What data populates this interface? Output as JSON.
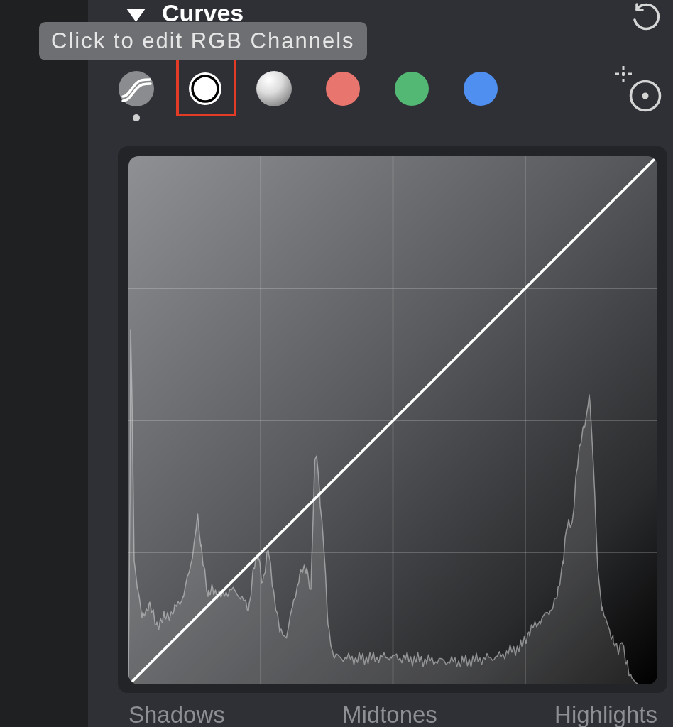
{
  "section": {
    "title": "Curves",
    "expanded": true
  },
  "tooltip": {
    "text": "Click to edit RGB Channels"
  },
  "channels": [
    {
      "kind": "luminance",
      "indicator": true,
      "highlighted": false
    },
    {
      "kind": "rgb",
      "indicator": false,
      "highlighted": true
    },
    {
      "kind": "white",
      "indicator": false,
      "highlighted": false
    },
    {
      "kind": "color",
      "color": "#e8756e",
      "indicator": false,
      "highlighted": false
    },
    {
      "kind": "color",
      "color": "#52b874",
      "indicator": false,
      "highlighted": false
    },
    {
      "kind": "color",
      "color": "#4e8ff0",
      "indicator": false,
      "highlighted": false
    }
  ],
  "curves_graph": {
    "tone_labels": [
      "Shadows",
      "Midtones",
      "Highlights"
    ]
  }
}
